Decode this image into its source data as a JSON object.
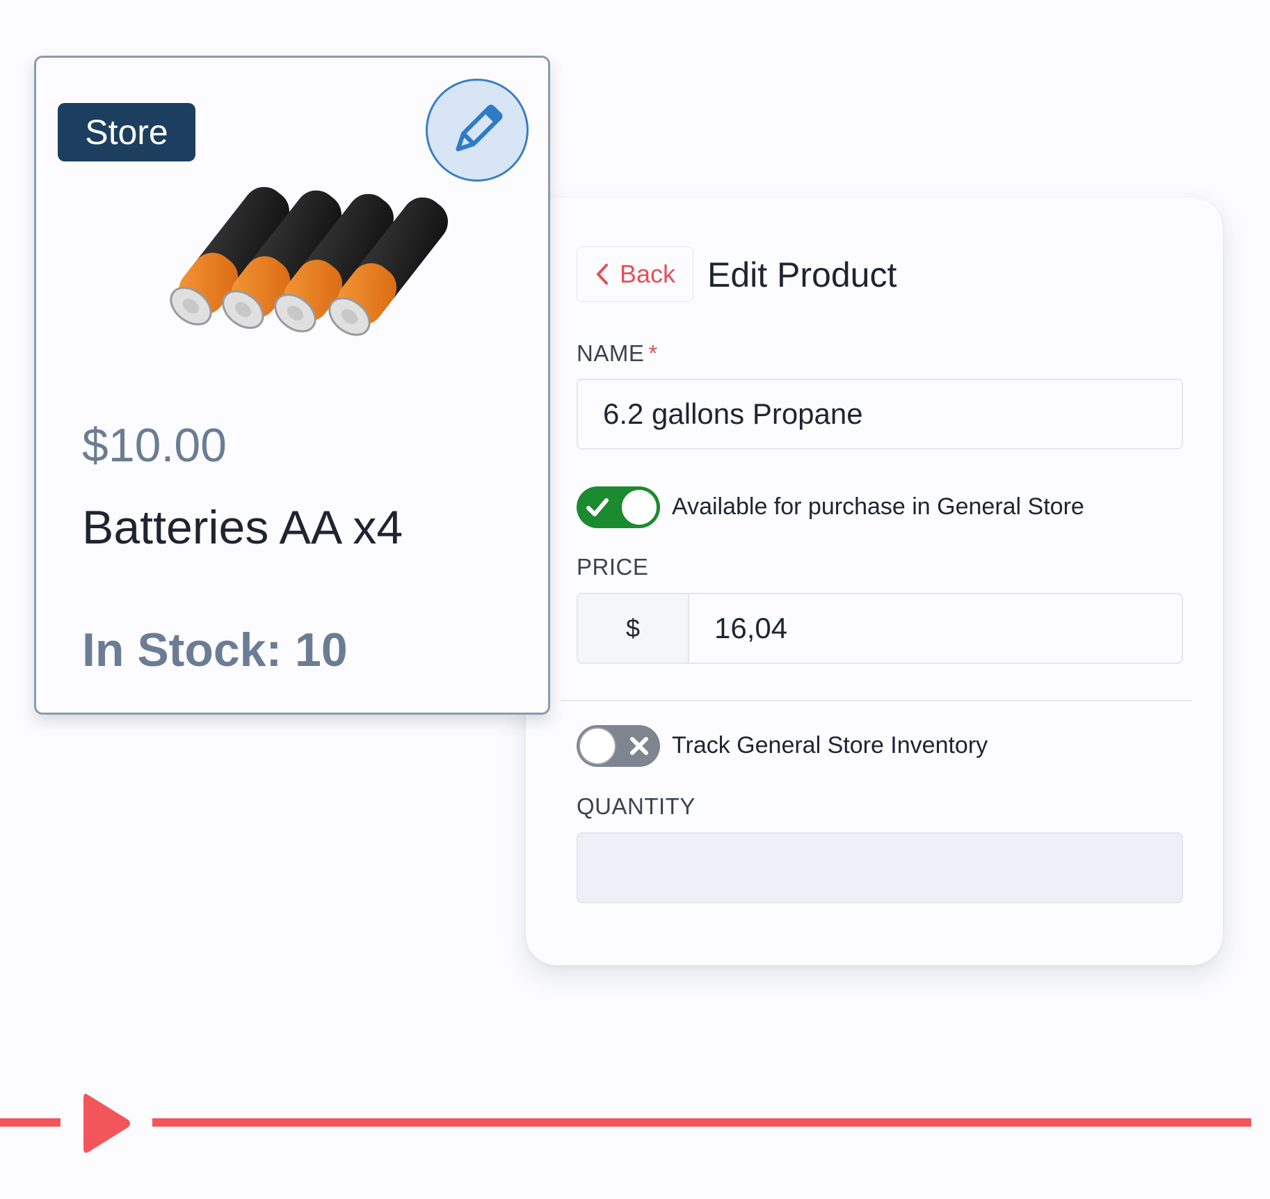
{
  "card": {
    "badge": "Store",
    "price": "$10.00",
    "name": "Batteries AA x4",
    "stock": "In Stock: 10",
    "edit_icon": "pencil-icon",
    "image": "aa-batteries"
  },
  "panel": {
    "back_label": "Back",
    "title": "Edit Product",
    "name_label": "NAME",
    "name_required": "*",
    "name_value": "6.2  gallons Propane",
    "available_toggle": {
      "on": true,
      "label": "Available for purchase in General Store"
    },
    "price_label": "PRICE",
    "price_prefix": "$",
    "price_value": "16,04",
    "track_toggle": {
      "on": false,
      "label": "Track General Store Inventory"
    },
    "quantity_label": "QUANTITY",
    "quantity_value": ""
  },
  "timeline": {
    "play_icon": "play-icon",
    "color": "#f2555a"
  },
  "colors": {
    "badge": "#1d3f5f",
    "accent_red": "#e2505a",
    "toggle_on": "#1c8a2e",
    "toggle_off": "#7e8591",
    "muted_text": "#6b7d94",
    "edit_button": "#3a7fc2"
  }
}
